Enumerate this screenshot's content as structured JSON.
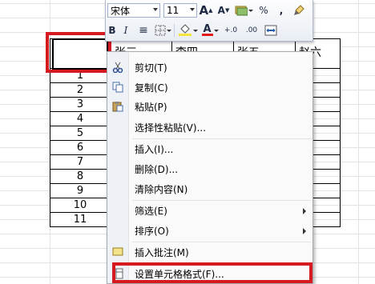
{
  "toolbar": {
    "font_name": "宋体",
    "font_size": "11",
    "grow_font": "A",
    "shrink_font": "A",
    "percent": "%",
    "comma": ",",
    "bold": "B",
    "italic": "I",
    "align_center": "≡",
    "font_color_letter": "A",
    "inc_decimal": "+.0",
    "dec_decimal": ".00"
  },
  "table": {
    "headers": [
      "张三",
      "李四",
      "张五",
      "赵六"
    ],
    "row_numbers": [
      "1",
      "2",
      "3",
      "4",
      "5",
      "6",
      "7",
      "8",
      "9",
      "10",
      "11"
    ]
  },
  "menu": {
    "items": [
      {
        "label": "剪切(T)",
        "icon": "scissors-icon"
      },
      {
        "label": "复制(C)",
        "icon": "copy-icon"
      },
      {
        "label": "粘贴(P)",
        "icon": "paste-icon"
      },
      {
        "label": "选择性粘贴(V)..."
      },
      {
        "label": "插入(I)..."
      },
      {
        "label": "删除(D)..."
      },
      {
        "label": "清除内容(N)"
      },
      {
        "label": "筛选(E)",
        "submenu": true
      },
      {
        "label": "排序(O)",
        "submenu": true
      },
      {
        "label": "插入批注(M)",
        "icon": "comment-icon"
      },
      {
        "label": "设置单元格格式(F)...",
        "icon": "format-cells-icon"
      }
    ]
  },
  "colors": {
    "highlight_red": "#d71920",
    "font_color_bar": "#e11b1b",
    "fill_color_bar": "#f5e43a"
  }
}
